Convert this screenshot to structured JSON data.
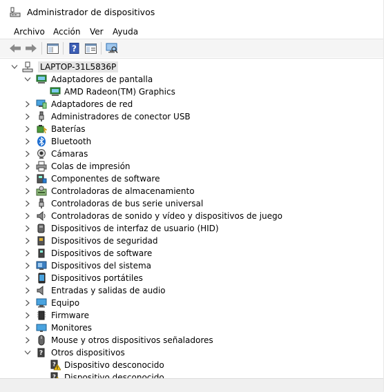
{
  "window": {
    "title": "Administrador de dispositivos"
  },
  "menu": [
    "Archivo",
    "Acción",
    "Ver",
    "Ayuda"
  ],
  "toolbar": {
    "buttons": [
      "back-arrow",
      "forward-arrow",
      "show-hide-console-tree",
      "help",
      "properties",
      "scan-hardware"
    ]
  },
  "tree": {
    "root": "LAPTOP-31L5836P",
    "items": [
      {
        "label": "Adaptadores de pantalla",
        "icon": "display-adapter",
        "expanded": true,
        "children": [
          {
            "label": "AMD Radeon(TM) Graphics",
            "icon": "display-adapter"
          }
        ]
      },
      {
        "label": "Adaptadores de red",
        "icon": "network-adapter"
      },
      {
        "label": "Administradores de conector USB",
        "icon": "usb-connector"
      },
      {
        "label": "Baterías",
        "icon": "battery"
      },
      {
        "label": "Bluetooth",
        "icon": "bluetooth"
      },
      {
        "label": "Cámaras",
        "icon": "camera"
      },
      {
        "label": "Colas de impresión",
        "icon": "printer"
      },
      {
        "label": "Componentes de software",
        "icon": "software-component"
      },
      {
        "label": "Controladoras de almacenamiento",
        "icon": "storage-controller"
      },
      {
        "label": "Controladoras de bus serie universal",
        "icon": "usb-controller"
      },
      {
        "label": "Controladoras de sonido y vídeo y dispositivos de juego",
        "icon": "sound"
      },
      {
        "label": "Dispositivos de interfaz de usuario (HID)",
        "icon": "hid"
      },
      {
        "label": "Dispositivos de seguridad",
        "icon": "security-device"
      },
      {
        "label": "Dispositivos de software",
        "icon": "software-device"
      },
      {
        "label": "Dispositivos del sistema",
        "icon": "system-device"
      },
      {
        "label": "Dispositivos portátiles",
        "icon": "portable-device"
      },
      {
        "label": "Entradas y salidas de audio",
        "icon": "audio-io"
      },
      {
        "label": "Equipo",
        "icon": "computer"
      },
      {
        "label": "Firmware",
        "icon": "firmware"
      },
      {
        "label": "Monitores",
        "icon": "monitor"
      },
      {
        "label": "Mouse y otros dispositivos señaladores",
        "icon": "mouse"
      },
      {
        "label": "Otros dispositivos",
        "icon": "other-devices",
        "expanded": true,
        "children": [
          {
            "label": "Dispositivo desconocido",
            "icon": "unknown-device-warning"
          },
          {
            "label": "Dispositivo desconocido",
            "icon": "unknown-device-warning"
          }
        ]
      }
    ]
  }
}
